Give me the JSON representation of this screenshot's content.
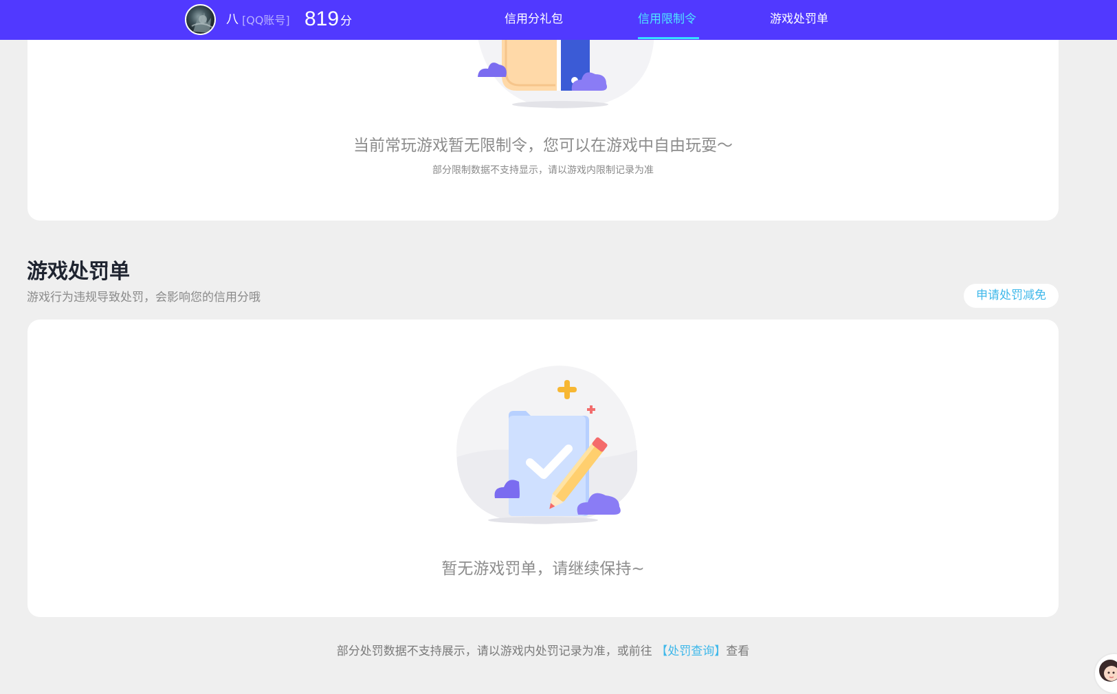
{
  "header": {
    "user_name": "八",
    "account_type": "[QQ账号]",
    "score": "819",
    "score_unit": "分",
    "tabs": [
      {
        "label": "信用分礼包",
        "active": false
      },
      {
        "label": "信用限制令",
        "active": true
      },
      {
        "label": "游戏处罚单",
        "active": false
      }
    ],
    "background_color": "#5139ff",
    "active_color": "#4fe6ff"
  },
  "restriction": {
    "empty_title": "当前常玩游戏暂无限制令，您可以在游戏中自由玩耍～",
    "empty_note": "部分限制数据不支持显示，请以游戏内限制记录为准"
  },
  "penalty": {
    "title": "游戏处罚单",
    "description": "游戏行为违规导致处罚，会影响您的信用分哦",
    "appeal_label": "申请处罚减免",
    "empty_title": "暂无游戏罚单，请继续保持~"
  },
  "footer": {
    "note_prefix": "部分处罚数据不支持展示，请以游戏内处罚记录为准，或前往",
    "link_label": "【处罚查询】",
    "note_suffix": "查看"
  },
  "icons": {
    "thumbs_up_illustration": "thumbs-up-illustration",
    "folder_check_illustration": "folder-check-illustration",
    "support_avatar": "support-avatar-icon"
  }
}
